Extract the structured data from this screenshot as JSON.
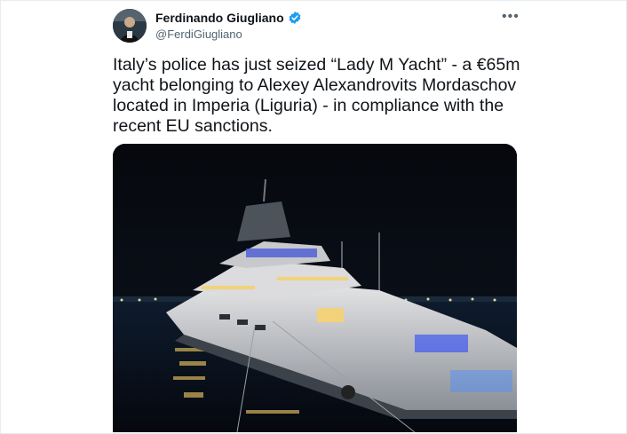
{
  "tweet": {
    "author_name": "Ferdinando Giugliano",
    "author_handle": "@FerdiGiugliano",
    "verified": true,
    "more_icon": "more-dots-icon",
    "text": "Italy’s police has just seized “Lady M Yacht” - a €65m yacht belonging to Alexey Alexandrovits Mordaschov located in Imperia (Liguria) - in compliance with the recent EU sanctions."
  },
  "colors": {
    "verified_blue": "#1d9bf0",
    "text": "#0f1419",
    "secondary_text": "#536471"
  }
}
